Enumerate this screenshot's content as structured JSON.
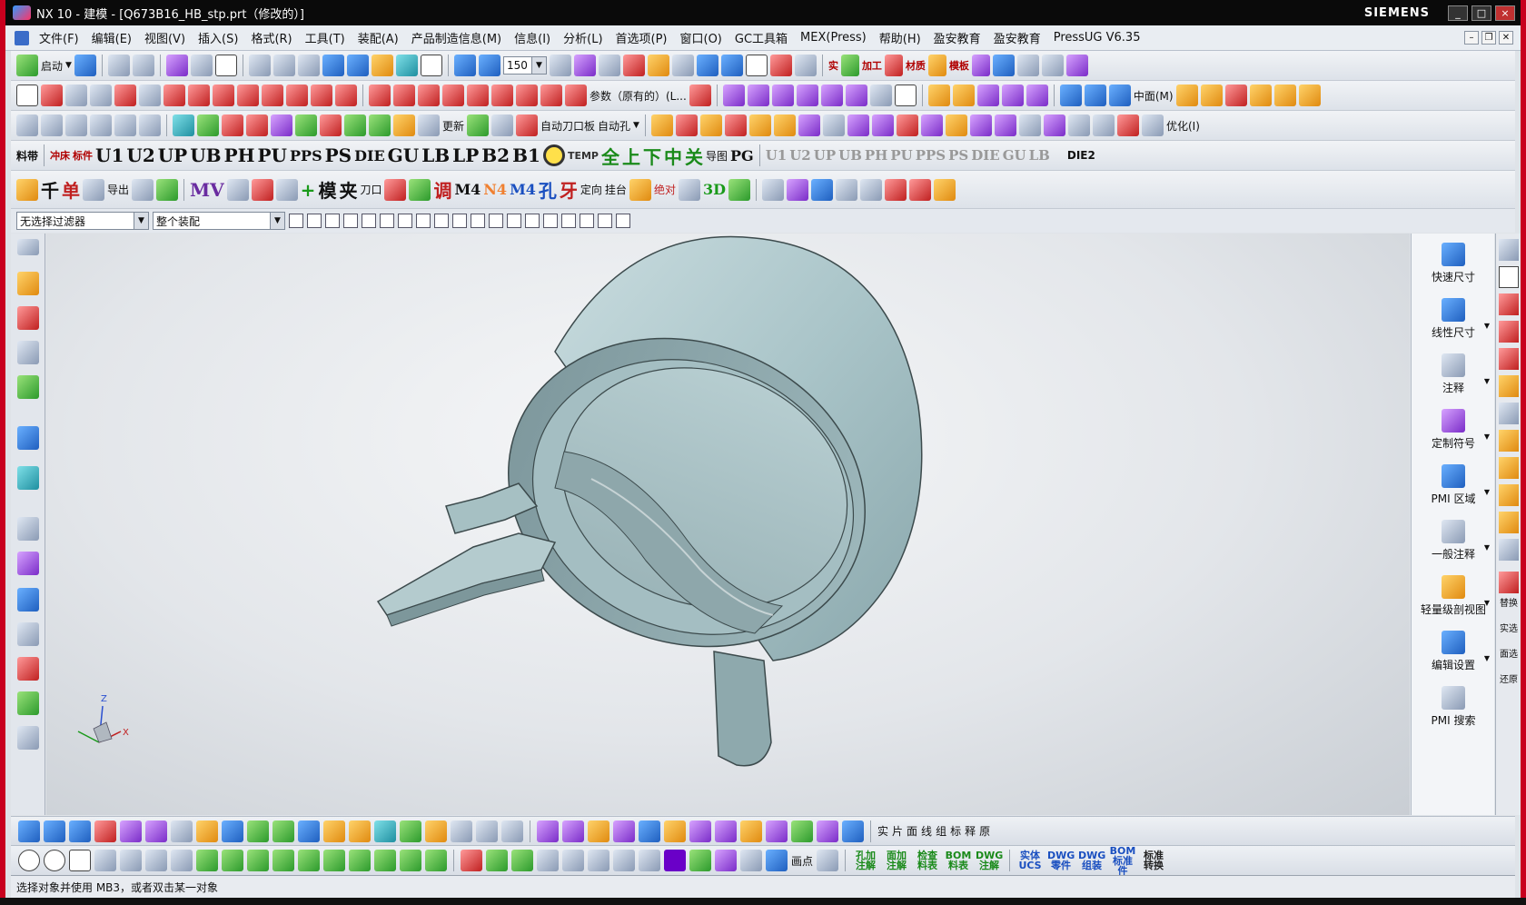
{
  "window": {
    "title": "NX 10 - 建模 - [Q673B16_HB_stp.prt（修改的）]",
    "brand": "SIEMENS",
    "controls": [
      "_",
      "□",
      "×"
    ]
  },
  "menubar": {
    "items": [
      "文件(F)",
      "编辑(E)",
      "视图(V)",
      "插入(S)",
      "格式(R)",
      "工具(T)",
      "装配(A)",
      "产品制造信息(M)",
      "信息(I)",
      "分析(L)",
      "首选项(P)",
      "窗口(O)",
      "GC工具箱",
      "MEX(Press)",
      "帮助(H)",
      "盈安教育",
      "盈安教育",
      "PressUG V6.35"
    ]
  },
  "toolbar1": {
    "start_label": "启动",
    "zoom_value": "150",
    "labels": [
      "实",
      "加工",
      "材质",
      "模板"
    ]
  },
  "toolbar2": {
    "param_label": "参数（原有的）(L...",
    "face_label": "中面(M)"
  },
  "toolbar3": {
    "labels": [
      "自动刀口板",
      "自动孔",
      "更新",
      "优化(I)"
    ]
  },
  "toolbar4": {
    "left_labels": [
      "料带",
      "冲床",
      "标件"
    ],
    "big_labels": [
      "U1",
      "U2",
      "UP",
      "UB",
      "PH",
      "PU",
      "PPS",
      "PS",
      "DIE",
      "GU",
      "LB",
      "LP",
      "B2",
      "B1"
    ],
    "chinese_labels": [
      "全",
      "上",
      "下",
      "中",
      "关"
    ],
    "other_labels": [
      "TEMP",
      "导图",
      "PG"
    ],
    "small_labels": [
      "U1",
      "U2",
      "UP",
      "UB",
      "PH",
      "PU",
      "PPS",
      "PS",
      "DIE",
      "GU",
      "LB"
    ],
    "end_label": "DIE2"
  },
  "toolbar5": {
    "labels": [
      "千",
      "单",
      "导出",
      "模",
      "夹",
      "刀口",
      "调",
      "M4",
      "N4",
      "M4",
      "孔",
      "牙",
      "定向",
      "挂台",
      "绝对"
    ],
    "mv_label": "MV",
    "threed_label": "3D"
  },
  "filterbar": {
    "selection_filter": "无选择过滤器",
    "scope": "整个装配"
  },
  "pmi_panel": {
    "items": [
      "快速尺寸",
      "线性尺寸",
      "注释",
      "定制符号",
      "PMI 区域",
      "一般注释",
      "轻量级剖视图",
      "编辑设置",
      "PMI 搜索"
    ]
  },
  "farright": {
    "items": [
      "替换",
      "实选",
      "面选",
      "还原"
    ]
  },
  "bottom1": {
    "labels": [
      "实",
      "片",
      "面",
      "线",
      "组",
      "标",
      "释",
      "原"
    ]
  },
  "bottom2": {
    "point_label": "画点",
    "tool_labels": [
      "孔加注解",
      "面加注解",
      "检查料表",
      "BOM料表",
      "DWG注解",
      "实体UCS",
      "DWG零件",
      "DWG组装",
      "BOM标准件",
      "标准转换"
    ]
  },
  "status": {
    "message": "选择对象并使用 MB3，或者双击某一对象"
  },
  "colors": {
    "titlebar": "#0a0a0a",
    "frame_accent": "#c8001e",
    "model_face": "#a9c4c8",
    "viewport_bg": "#e3e6ea"
  }
}
